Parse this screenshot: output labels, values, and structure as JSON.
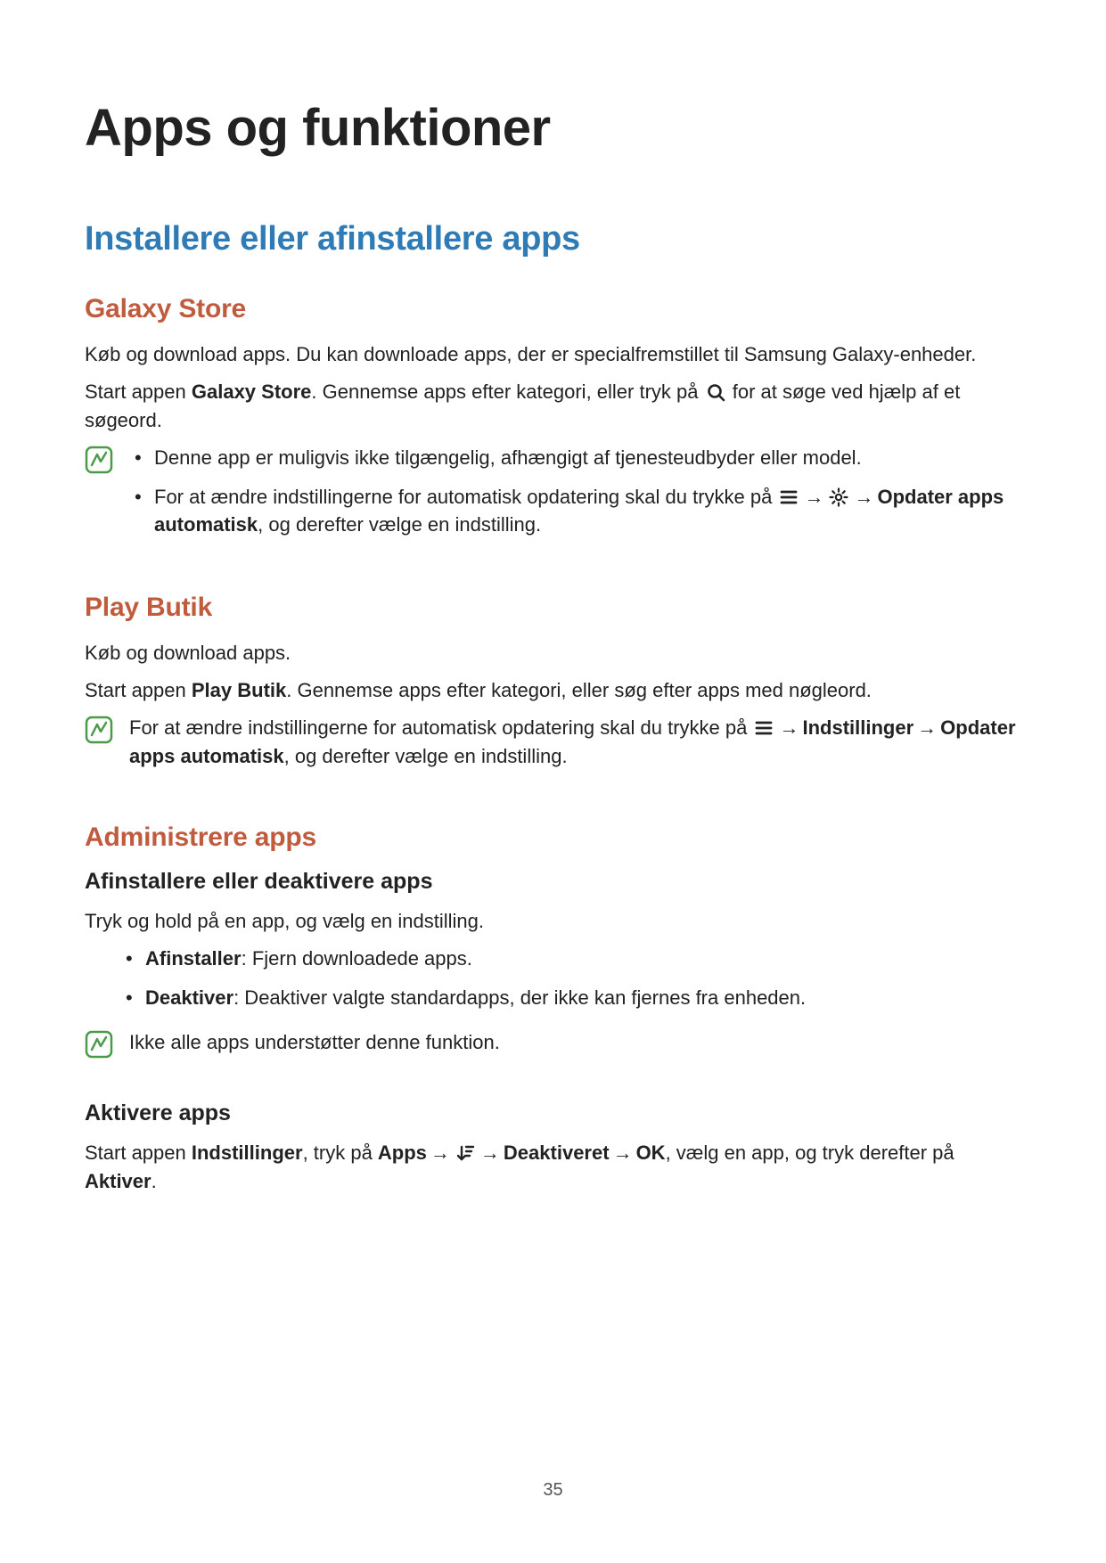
{
  "page_number": "35",
  "h1": "Apps og funktioner",
  "h2": "Installere eller afinstallere apps",
  "galaxy": {
    "h3": "Galaxy Store",
    "p1": "Køb og download apps. Du kan downloade apps, der er specialfremstillet til Samsung Galaxy-enheder.",
    "p2a": "Start appen ",
    "p2b": "Galaxy Store",
    "p2c": ". Gennemse apps efter kategori, eller tryk på ",
    "p2d": " for at søge ved hjælp af et søgeord.",
    "note": {
      "li1": "Denne app er muligvis ikke tilgængelig, afhængigt af tjenesteudbyder eller model.",
      "li2a": "For at ændre indstillingerne for automatisk opdatering skal du trykke på ",
      "li2b": " → ",
      "li2c": " → ",
      "li2d": "Opdater apps automatisk",
      "li2e": ", og derefter vælge en indstilling."
    }
  },
  "play": {
    "h3": "Play Butik",
    "p1": "Køb og download apps.",
    "p2a": "Start appen ",
    "p2b": "Play Butik",
    "p2c": ". Gennemse apps efter kategori, eller søg efter apps med nøgleord.",
    "note": {
      "a": "For at ændre indstillingerne for automatisk opdatering skal du trykke på ",
      "b": " → ",
      "c": "Indstillinger",
      "d": " → ",
      "e": "Opdater apps automatisk",
      "f": ", og derefter vælge en indstilling."
    }
  },
  "admin": {
    "h3": "Administrere apps",
    "uninstall": {
      "h4": "Afinstallere eller deaktivere apps",
      "p1": "Tryk og hold på en app, og vælg en indstilling.",
      "li1a": "Afinstaller",
      "li1b": ": Fjern downloadede apps.",
      "li2a": "Deaktiver",
      "li2b": ": Deaktiver valgte standardapps, der ikke kan fjernes fra enheden.",
      "note": "Ikke alle apps understøtter denne funktion."
    },
    "activate": {
      "h4": "Aktivere apps",
      "a": "Start appen ",
      "b": "Indstillinger",
      "c": ", tryk på ",
      "d": "Apps",
      "e": " → ",
      "f": " → ",
      "g": "Deaktiveret",
      "h": " → ",
      "i": "OK",
      "j": ", vælg en app, og tryk derefter på ",
      "k": "Aktiver",
      "l": "."
    }
  }
}
